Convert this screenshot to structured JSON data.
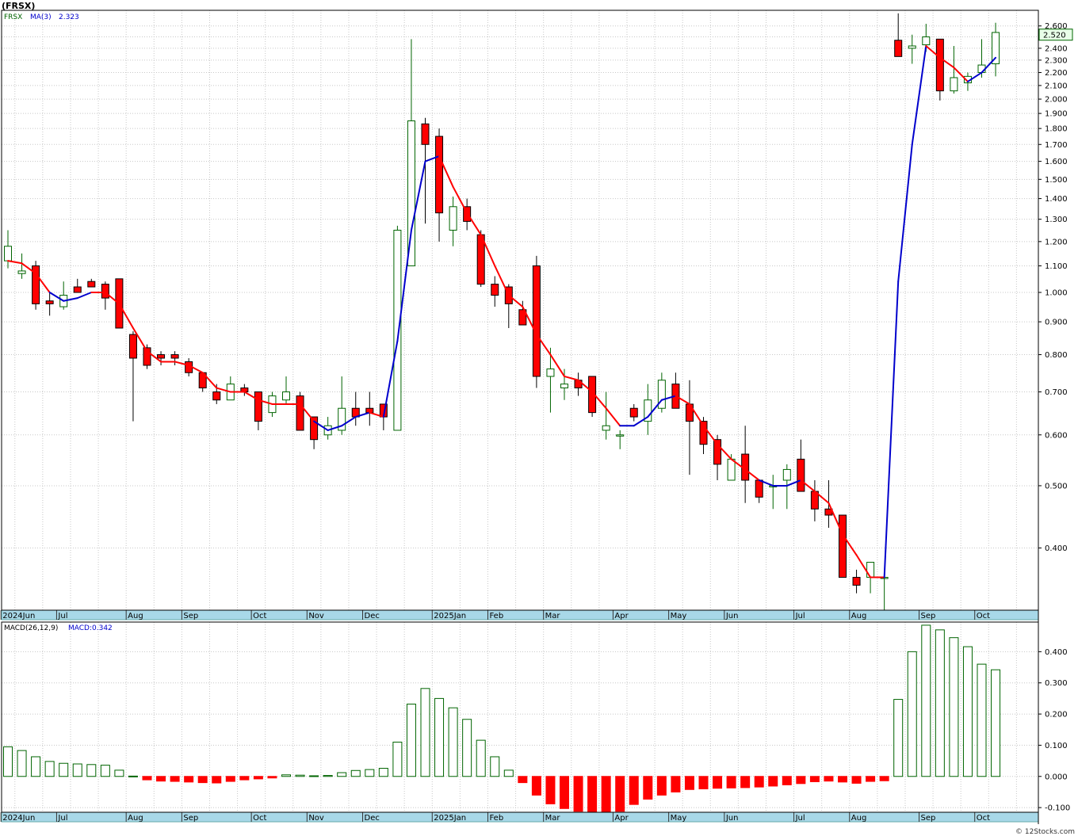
{
  "ticker": "(FRSX)",
  "watermark": "© 12Stocks.com",
  "colors": {
    "up_candle": "#006400",
    "down_candle": "#ff0000",
    "ma_up": "#0000cc",
    "ma_down": "#ff0000",
    "macd_bar": "#006400",
    "axis_strip": "#a8d8e8",
    "grid": "#c8c8c8",
    "price_badge": "#006400"
  },
  "chart_data": {
    "type": "candlestick",
    "price_panel": {
      "legend": {
        "symbol": "FRSX",
        "ma_label": "MA(3)",
        "ma_value": "2.323"
      },
      "last_price": "2.520",
      "scale": "log",
      "ylim": [
        0.32,
        2.75
      ],
      "yticks": [
        "2.600",
        "2.500",
        "2.400",
        "2.300",
        "2.200",
        "2.100",
        "2.000",
        "1.900",
        "1.800",
        "1.700",
        "1.600",
        "1.500",
        "1.400",
        "1.300",
        "1.200",
        "1.100",
        "1.000",
        "0.900",
        "0.800",
        "0.700",
        "0.600",
        "0.500",
        "0.400"
      ],
      "month_labels": [
        {
          "label": "2024Jun",
          "week": 0
        },
        {
          "label": "Jul",
          "week": 4
        },
        {
          "label": "Aug",
          "week": 9
        },
        {
          "label": "Sep",
          "week": 13
        },
        {
          "label": "Oct",
          "week": 18
        },
        {
          "label": "Nov",
          "week": 22
        },
        {
          "label": "Dec",
          "week": 26
        },
        {
          "label": "2025Jan",
          "week": 31
        },
        {
          "label": "Feb",
          "week": 35
        },
        {
          "label": "Mar",
          "week": 39
        },
        {
          "label": "Apr",
          "week": 44
        },
        {
          "label": "May",
          "week": 48
        },
        {
          "label": "Jun",
          "week": 52
        },
        {
          "label": "Jul",
          "week": 57
        },
        {
          "label": "Aug",
          "week": 61
        },
        {
          "label": "Sep",
          "week": 66
        },
        {
          "label": "Oct",
          "week": 70
        }
      ],
      "candles": [
        [
          1.12,
          1.25,
          1.09,
          1.18
        ],
        [
          1.07,
          1.15,
          1.05,
          1.08
        ],
        [
          1.1,
          1.12,
          0.94,
          0.96
        ],
        [
          0.97,
          1.0,
          0.92,
          0.96
        ],
        [
          0.95,
          1.04,
          0.94,
          0.99
        ],
        [
          1.02,
          1.05,
          1.0,
          1.0
        ],
        [
          1.04,
          1.05,
          1.02,
          1.02
        ],
        [
          1.03,
          1.04,
          0.94,
          0.98
        ],
        [
          1.05,
          1.05,
          0.88,
          0.88
        ],
        [
          0.86,
          0.87,
          0.63,
          0.79
        ],
        [
          0.82,
          0.83,
          0.76,
          0.77
        ],
        [
          0.8,
          0.81,
          0.77,
          0.79
        ],
        [
          0.8,
          0.81,
          0.77,
          0.79
        ],
        [
          0.78,
          0.79,
          0.74,
          0.75
        ],
        [
          0.75,
          0.75,
          0.7,
          0.71
        ],
        [
          0.7,
          0.72,
          0.67,
          0.68
        ],
        [
          0.68,
          0.74,
          0.68,
          0.72
        ],
        [
          0.71,
          0.72,
          0.69,
          0.7
        ],
        [
          0.7,
          0.7,
          0.61,
          0.63
        ],
        [
          0.65,
          0.7,
          0.64,
          0.69
        ],
        [
          0.68,
          0.74,
          0.67,
          0.7
        ],
        [
          0.69,
          0.7,
          0.61,
          0.61
        ],
        [
          0.64,
          0.64,
          0.57,
          0.59
        ],
        [
          0.6,
          0.64,
          0.59,
          0.62
        ],
        [
          0.61,
          0.74,
          0.6,
          0.66
        ],
        [
          0.66,
          0.7,
          0.62,
          0.64
        ],
        [
          0.66,
          0.7,
          0.62,
          0.65
        ],
        [
          0.67,
          0.67,
          0.61,
          0.64
        ],
        [
          0.61,
          1.27,
          0.61,
          1.25
        ],
        [
          1.1,
          2.48,
          1.1,
          1.85
        ],
        [
          1.83,
          1.87,
          1.28,
          1.7
        ],
        [
          1.75,
          1.8,
          1.2,
          1.33
        ],
        [
          1.25,
          1.41,
          1.18,
          1.36
        ],
        [
          1.36,
          1.4,
          1.25,
          1.29
        ],
        [
          1.23,
          1.25,
          1.02,
          1.03
        ],
        [
          1.03,
          1.06,
          0.95,
          0.99
        ],
        [
          1.02,
          1.03,
          0.88,
          0.96
        ],
        [
          0.94,
          0.97,
          0.89,
          0.89
        ],
        [
          1.1,
          1.14,
          0.71,
          0.74
        ],
        [
          0.74,
          0.82,
          0.65,
          0.76
        ],
        [
          0.71,
          0.76,
          0.68,
          0.72
        ],
        [
          0.73,
          0.75,
          0.69,
          0.71
        ],
        [
          0.74,
          0.74,
          0.64,
          0.65
        ],
        [
          0.61,
          0.7,
          0.59,
          0.62
        ],
        [
          0.6,
          0.61,
          0.57,
          0.6
        ],
        [
          0.66,
          0.67,
          0.63,
          0.64
        ],
        [
          0.63,
          0.72,
          0.6,
          0.68
        ],
        [
          0.66,
          0.75,
          0.65,
          0.73
        ],
        [
          0.72,
          0.75,
          0.66,
          0.66
        ],
        [
          0.67,
          0.73,
          0.52,
          0.63
        ],
        [
          0.63,
          0.64,
          0.56,
          0.58
        ],
        [
          0.59,
          0.6,
          0.51,
          0.54
        ],
        [
          0.51,
          0.56,
          0.51,
          0.55
        ],
        [
          0.56,
          0.62,
          0.47,
          0.51
        ],
        [
          0.51,
          0.51,
          0.47,
          0.48
        ],
        [
          0.5,
          0.52,
          0.46,
          0.5
        ],
        [
          0.51,
          0.54,
          0.46,
          0.53
        ],
        [
          0.55,
          0.59,
          0.49,
          0.49
        ],
        [
          0.49,
          0.51,
          0.44,
          0.46
        ],
        [
          0.46,
          0.51,
          0.43,
          0.45
        ],
        [
          0.45,
          0.45,
          0.36,
          0.36
        ],
        [
          0.36,
          0.37,
          0.34,
          0.35
        ],
        [
          0.36,
          0.38,
          0.34,
          0.38
        ],
        [
          0.36,
          0.36,
          0.32,
          0.36
        ],
        [
          2.47,
          2.72,
          2.33,
          2.33
        ],
        [
          2.4,
          2.52,
          2.27,
          2.42
        ],
        [
          2.43,
          2.62,
          2.37,
          2.5
        ],
        [
          2.48,
          2.48,
          1.99,
          2.06
        ],
        [
          2.06,
          2.42,
          2.04,
          2.16
        ],
        [
          2.12,
          2.2,
          2.06,
          2.17
        ],
        [
          2.2,
          2.48,
          2.16,
          2.26
        ],
        [
          2.27,
          2.63,
          2.17,
          2.54
        ]
      ],
      "ma3": [
        1.12,
        1.11,
        1.07,
        1.0,
        0.97,
        0.98,
        1.0,
        1.0,
        0.96,
        0.88,
        0.81,
        0.78,
        0.78,
        0.77,
        0.75,
        0.71,
        0.7,
        0.7,
        0.68,
        0.67,
        0.67,
        0.67,
        0.63,
        0.61,
        0.62,
        0.64,
        0.65,
        0.64,
        0.84,
        1.25,
        1.6,
        1.63,
        1.46,
        1.33,
        1.23,
        1.1,
        0.99,
        0.95,
        0.86,
        0.8,
        0.74,
        0.73,
        0.7,
        0.66,
        0.62,
        0.62,
        0.64,
        0.68,
        0.69,
        0.67,
        0.62,
        0.58,
        0.55,
        0.53,
        0.51,
        0.5,
        0.5,
        0.51,
        0.49,
        0.47,
        0.42,
        0.39,
        0.36,
        0.36,
        1.04,
        1.7,
        2.42,
        2.32,
        2.24,
        2.13,
        2.2,
        2.32
      ],
      "ma_up_flags": [
        0,
        0,
        0,
        0,
        1,
        1,
        1,
        0,
        0,
        0,
        0,
        0,
        0,
        0,
        0,
        0,
        0,
        0,
        0,
        0,
        0,
        0,
        0,
        1,
        1,
        1,
        1,
        0,
        1,
        1,
        1,
        1,
        0,
        0,
        0,
        0,
        0,
        0,
        0,
        0,
        0,
        0,
        0,
        0,
        0,
        1,
        1,
        1,
        1,
        0,
        0,
        0,
        0,
        0,
        0,
        1,
        1,
        1,
        0,
        0,
        0,
        0,
        0,
        0,
        1,
        1,
        1,
        0,
        0,
        0,
        1,
        1
      ]
    },
    "macd_panel": {
      "legend": {
        "label": "MACD(26,12,9)",
        "value_label": "MACD:0.342"
      },
      "ylim": [
        -0.115,
        0.495
      ],
      "yticks": [
        "0.400",
        "0.300",
        "0.200",
        "0.100",
        "0.000",
        "-0.100"
      ],
      "values": [
        0.095,
        0.083,
        0.063,
        0.048,
        0.042,
        0.04,
        0.038,
        0.036,
        0.02,
        0.001,
        -0.011,
        -0.015,
        -0.016,
        -0.018,
        -0.02,
        -0.021,
        -0.016,
        -0.011,
        -0.008,
        -0.005,
        0.005,
        0.004,
        0.002,
        0.003,
        0.012,
        0.019,
        0.022,
        0.026,
        0.11,
        0.232,
        0.282,
        0.25,
        0.22,
        0.183,
        0.116,
        0.063,
        0.02,
        -0.02,
        -0.06,
        -0.088,
        -0.103,
        -0.112,
        -0.118,
        -0.123,
        -0.112,
        -0.09,
        -0.073,
        -0.06,
        -0.05,
        -0.042,
        -0.04,
        -0.038,
        -0.037,
        -0.036,
        -0.034,
        -0.031,
        -0.027,
        -0.023,
        -0.017,
        -0.015,
        -0.018,
        -0.022,
        -0.016,
        -0.014,
        0.247,
        0.4,
        0.485,
        0.47,
        0.445,
        0.416,
        0.36,
        0.342
      ]
    }
  }
}
